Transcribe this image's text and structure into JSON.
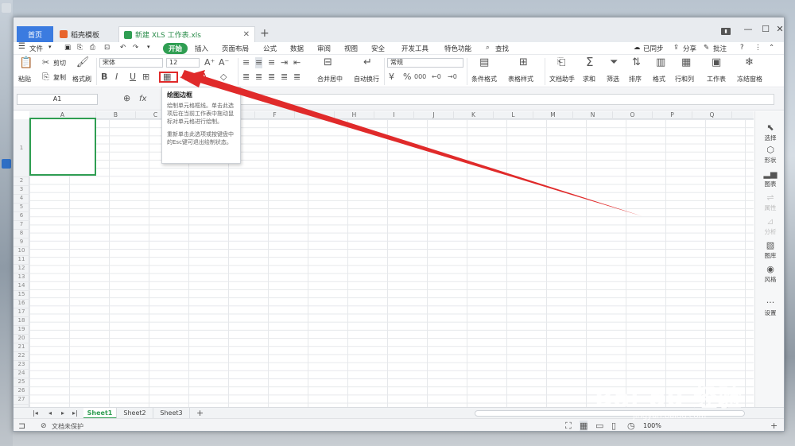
{
  "tabs": {
    "home": "首页",
    "templates": "稻壳模板",
    "doc": "新建 XLS 工作表.xls"
  },
  "menu": {
    "file": "文件",
    "start": "开始",
    "items": [
      "插入",
      "页面布局",
      "公式",
      "数据",
      "审阅",
      "视图",
      "安全",
      "开发工具",
      "特色功能"
    ],
    "search": "查找",
    "sync": "已同步",
    "share": "分享",
    "annotate": "批注"
  },
  "ribbon": {
    "paste": "粘贴",
    "cut": "剪切",
    "copy": "复制",
    "format_painter": "格式刷",
    "font": "宋体",
    "size": "12",
    "bold": "B",
    "italic": "I",
    "underline": "U",
    "merge": "合并居中",
    "wrap": "自动换行",
    "number_format": "常规",
    "percent": "%",
    "thousands": "000",
    "cond_format": "条件格式",
    "table_style": "表格样式",
    "doc_helper": "文档助手",
    "sum": "求和",
    "filter": "筛选",
    "sort": "排序",
    "format": "格式",
    "row_col": "行和列",
    "sheet": "工作表",
    "freeze": "冻结窗格"
  },
  "formula": {
    "cell_ref": "A1",
    "fx": "fx"
  },
  "columns": [
    "A",
    "B",
    "C",
    "D",
    "E",
    "F",
    "G",
    "H",
    "I",
    "J",
    "K",
    "L",
    "M",
    "N",
    "O",
    "P",
    "Q"
  ],
  "rows": [
    "1",
    "2",
    "3",
    "4",
    "5",
    "6",
    "7",
    "8",
    "9",
    "10",
    "11",
    "12",
    "13",
    "14",
    "15",
    "16",
    "17",
    "18",
    "19",
    "20",
    "21",
    "22",
    "23",
    "24",
    "25",
    "26",
    "27"
  ],
  "tooltip": {
    "title": "绘图边框",
    "body1": "绘制单元格框线。单击此选项后在当前工作表中拖动鼠标对单元格进行绘制。",
    "body2": "重新单击此选项或按键盘中的Esc键可退出绘制状态。"
  },
  "right_pane": [
    {
      "label": "选择",
      "icon": "cursor-icon"
    },
    {
      "label": "形状",
      "icon": "shapes-icon"
    },
    {
      "label": "图表",
      "icon": "chart-icon"
    },
    {
      "label": "属性",
      "icon": "properties-icon"
    },
    {
      "label": "分析",
      "icon": "analysis-icon"
    },
    {
      "label": "图库",
      "icon": "gallery-icon"
    },
    {
      "label": "风格",
      "icon": "style-icon"
    },
    {
      "label": "设置",
      "icon": "settings-icon"
    }
  ],
  "sheets": [
    "Sheet1",
    "Sheet2",
    "Sheet3"
  ],
  "status": {
    "protect": "文档未保护",
    "zoom": "100%"
  },
  "watermark": {
    "brand": "Bai du 经验",
    "url": "jingyan.baidu.com"
  },
  "colors": {
    "accent_green": "#2f9e52",
    "home_tab": "#3b7be0",
    "highlight_red": "#e02a2a"
  }
}
